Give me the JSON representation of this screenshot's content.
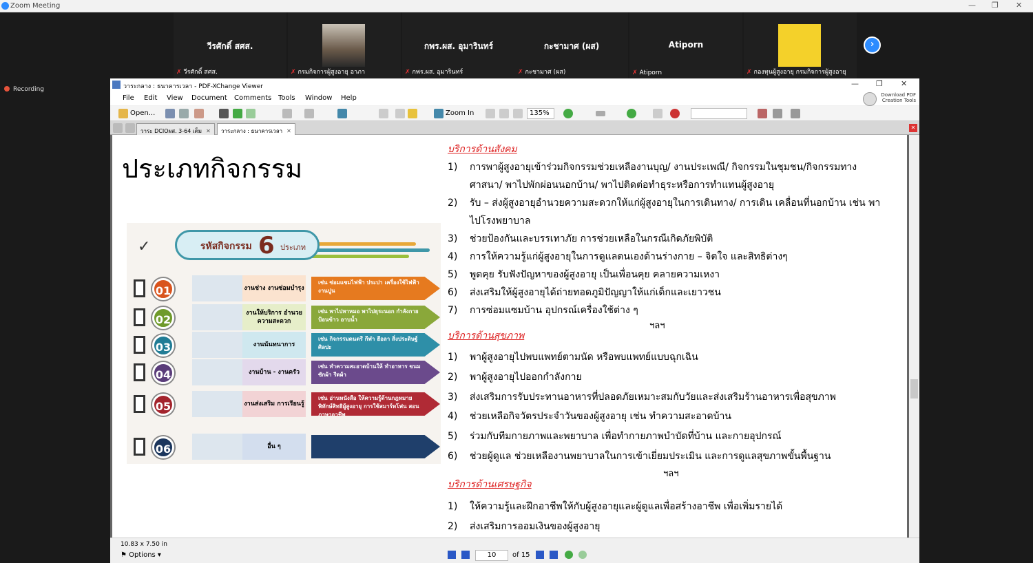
{
  "zoom": {
    "window_title": "Zoom Meeting",
    "recording_label": "Recording",
    "participants": [
      {
        "name": "วีรศักดิ์ สศส.",
        "sub": "วีรศักดิ์ สศส.",
        "has_photo": false
      },
      {
        "name": "",
        "sub": "กรมกิจการผู้สูงอายุ อาภา",
        "has_photo": true
      },
      {
        "name": "กพร.ผส. อุมารินทร์",
        "sub": "กพร.ผส. อุมารินทร์",
        "has_photo": false
      },
      {
        "name": "กะชามาศ (ผส)",
        "sub": "กะชามาศ (ผส)",
        "has_photo": false
      },
      {
        "name": "Atiporn",
        "sub": "Atiporn",
        "has_photo": false
      },
      {
        "name": "",
        "sub": "กองทุนผู้สูงอายุ กรมกิจการผู้สูงอายุ",
        "has_photo": true
      }
    ]
  },
  "viewer": {
    "title": "วาระกลาง : ธนาคารเวลา - PDF-XChange Viewer",
    "menu": [
      "File",
      "Edit",
      "View",
      "Document",
      "Comments",
      "Tools",
      "Window",
      "Help"
    ],
    "download_label_1": "Download PDF",
    "download_label_2": "Creation Tools",
    "toolbar_open": "Open...",
    "toolbar_zoom_in": "Zoom In",
    "zoom_value": "135%",
    "tabs": [
      "วาระ DCIOผส. 3-64 เต็ม",
      "วาระกลาง : ธนาคารเวลา"
    ],
    "status_size": "10.83 x 7.50 in",
    "options_label": "Options",
    "current_page": "10",
    "of_pages": "of 15"
  },
  "document": {
    "title": "ประเภทกิจกรรม",
    "infographic": {
      "banner_text": "รหัสกิจกรรม",
      "banner_number": "6",
      "banner_suffix": "ประเภท",
      "rows": [
        {
          "num": "01",
          "label": "งานช่าง งานซ่อมบำรุง",
          "desc": "เช่น ซ่อมแซมไฟฟ้า ประปา เครื่องใช้ไฟฟ้า งานปูน",
          "color": "#e67a1f",
          "num_color": "#d9541e",
          "label_bg": "#fbe3cf"
        },
        {
          "num": "02",
          "label": "งานให้บริการ อำนวยความสะดวก",
          "desc": "เช่น พาไปหาหมอ พาไปธุระนอก กำลังกาย ป้อนข้าว อาบน้ำ",
          "color": "#8aa83a",
          "num_color": "#6f9a2b",
          "label_bg": "#e6eec9"
        },
        {
          "num": "03",
          "label": "งานนันทนาการ",
          "desc": "เช่น กิจกรรมดนตรี กีฬา ฮือลา สิ่งประดิษฐ์ ศิลปะ",
          "color": "#2e8fa8",
          "num_color": "#217c95",
          "label_bg": "#cfe8ef"
        },
        {
          "num": "04",
          "label": "งานบ้าน - งานครัว",
          "desc": "เช่น ทำความสะอาดบ้านให้ ทำอาหาร ขนม ซักผ้า รีดผ้า",
          "color": "#6b4a8c",
          "num_color": "#5a3c7a",
          "label_bg": "#e3d9ec"
        },
        {
          "num": "05",
          "label": "งานส่งเสริม การเรียนรู้",
          "desc": "เช่น อ่านหนังสือ ให้ความรู้ด้านกฎหมาย พิทักษ์สิทธิผู้สูงอายุ การใช้สมาร์ทโฟน สอนภาษาอาชีพ",
          "color": "#b02a35",
          "num_color": "#a3242d",
          "label_bg": "#f2d3d5"
        },
        {
          "num": "06",
          "label": "อื่น ๆ",
          "desc": "",
          "color": "#1f3f6b",
          "num_color": "#1b355c",
          "label_bg": "#d3deee"
        }
      ]
    },
    "sections": [
      {
        "heading": "บริการด้านสังคม",
        "items": [
          {
            "n": "1)",
            "text": "การพาผู้สูงอายุเข้าร่วมกิจกรรมช่วยเหลืองานบุญ/ งานประเพณี/ กิจกรรมในชุมชน/กิจกรรมทาง ศาสนา/ พาไปพักผ่อนนอกบ้าน/ พาไปติดต่อทำธุระหรือการทำแทนผู้สูงอายุ"
          },
          {
            "n": "2)",
            "text": "รับ – ส่งผู้สูงอายุอำนวยความสะดวกให้แก่ผู้สูงอายุในการเดินทาง/ การเดิน เคลื่อนที่นอกบ้าน เช่น พาไปโรงพยาบาล"
          },
          {
            "n": "3)",
            "text": "ช่วยป้องกันและบรรเทาภัย การช่วยเหลือในกรณีเกิดภัยพิบัติ"
          },
          {
            "n": "4)",
            "text": "การให้ความรู้แก่ผู้สูงอายุในการดูแลตนเองด้านร่างกาย – จิตใจ และสิทธิต่างๆ"
          },
          {
            "n": "5)",
            "text": "พูดคุย รับฟังปัญหาของผู้สูงอายุ เป็นเพื่อนคุย คลายความเหงา"
          },
          {
            "n": "6)",
            "text": "ส่งเสริมให้ผู้สูงอายุได้ถ่ายทอดภูมิปัญญาให้แก่เด็กและเยาวชน"
          },
          {
            "n": "7)",
            "text": "การซ่อมแซมบ้าน อุปกรณ์เครื่องใช้ต่าง ๆ"
          }
        ],
        "etc": "ฯลฯ"
      },
      {
        "heading": "บริการด้านสุขภาพ",
        "items": [
          {
            "n": "1)",
            "text": "พาผู้สูงอายุไปพบแพทย์ตามนัด หรือพบแพทย์แบบฉุกเฉิน"
          },
          {
            "n": "2)",
            "text": "พาผู้สูงอายุไปออกกำลังกาย"
          },
          {
            "n": "3)",
            "text": "ส่งเสริมการรับประทานอาหารที่ปลอดภัยเหมาะสมกับวัยและส่งเสริมร้านอาหารเพื่อสุขภาพ"
          },
          {
            "n": "4)",
            "text": "ช่วยเหลือกิจวัตรประจำวันของผู้สูงอายุ เช่น ทำความสะอาดบ้าน"
          },
          {
            "n": "5)",
            "text": "ร่วมกับทีมกายภาพและพยาบาล เพื่อทำกายภาพบำบัดที่บ้าน และกายอุปกรณ์"
          },
          {
            "n": "6)",
            "text": "ช่วยผู้ดูแล ช่วยเหลืองานพยาบาลในการเข้าเยี่ยมประเมิน และการดูแลสุขภาพขั้นพื้นฐาน"
          }
        ],
        "etc": "ฯลฯ"
      },
      {
        "heading": "บริการด้านเศรษฐกิจ",
        "items": [
          {
            "n": "1)",
            "text": "ให้ความรู้และฝึกอาชีพให้กับผู้สูงอายุและผู้ดูแลเพื่อสร้างอาชีพ เพื่อเพิ่มรายได้"
          },
          {
            "n": "2)",
            "text": "ส่งเสริมการออมเงินของผู้สูงอายุ"
          }
        ]
      }
    ]
  }
}
